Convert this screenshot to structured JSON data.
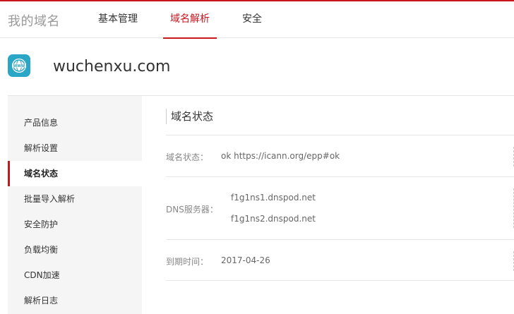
{
  "brand": "我的域名",
  "nav": {
    "tabs": [
      {
        "label": "基本管理",
        "active": false
      },
      {
        "label": "域名解析",
        "active": true
      },
      {
        "label": "安全",
        "active": false
      }
    ]
  },
  "colors": {
    "accent": "#c7161e",
    "icon_bg": "#2aa6c6"
  },
  "domain": {
    "name": "wuchenxu.com",
    "icon": "www-globe-icon",
    "icon_text": "WWW"
  },
  "sidebar": {
    "items": [
      {
        "label": "产品信息",
        "active": false
      },
      {
        "label": "解析设置",
        "active": false
      },
      {
        "label": "域名状态",
        "active": true
      },
      {
        "label": "批量导入解析",
        "active": false
      },
      {
        "label": "安全防护",
        "active": false
      },
      {
        "label": "负载均衡",
        "active": false
      },
      {
        "label": "CDN加速",
        "active": false
      },
      {
        "label": "解析日志",
        "active": false
      }
    ]
  },
  "main": {
    "title": "域名状态",
    "status": {
      "label": "域名状态：",
      "value": "ok https://icann.org/epp#ok"
    },
    "dns": {
      "label": "DNS服务器：",
      "servers": [
        "f1g1ns1.dnspod.net",
        "f1g1ns2.dnspod.net"
      ]
    },
    "expiry": {
      "label": "到期时间：",
      "value": "2017-04-26"
    }
  }
}
